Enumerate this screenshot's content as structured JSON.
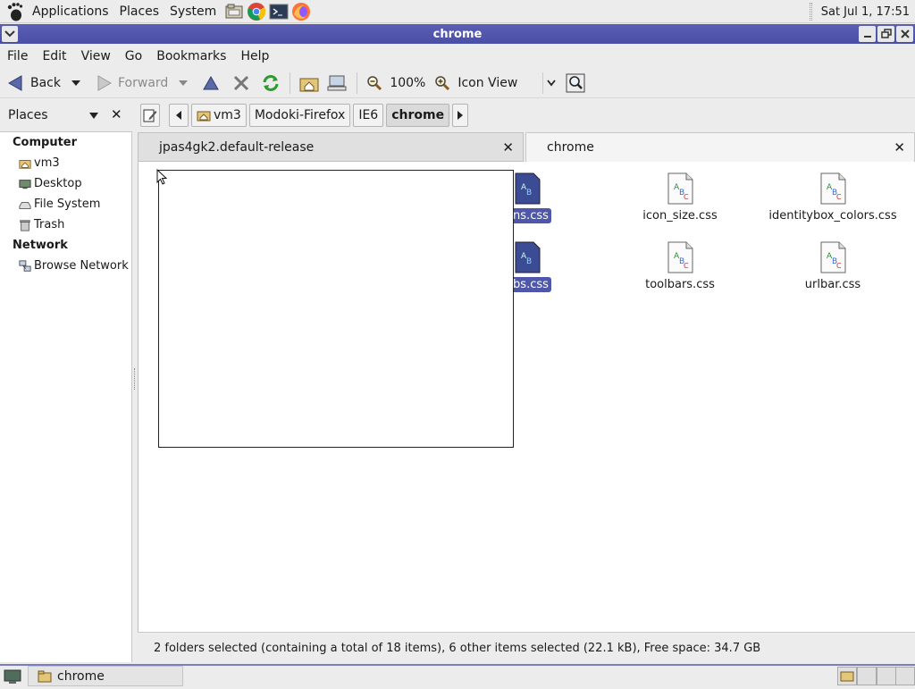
{
  "top_panel": {
    "menus": [
      "Applications",
      "Places",
      "System"
    ],
    "clock": "Sat Jul  1, 17:51",
    "launchers": [
      "file-manager-launcher-icon",
      "chrome-launcher-icon",
      "terminal-launcher-icon",
      "firefox-launcher-icon"
    ]
  },
  "window": {
    "title": "chrome"
  },
  "menubar": {
    "items": [
      "File",
      "Edit",
      "View",
      "Go",
      "Bookmarks",
      "Help"
    ]
  },
  "toolbar": {
    "back": "Back",
    "forward": "Forward",
    "zoom": "100%",
    "view_mode": "Icon View"
  },
  "sidebar": {
    "title": "Places",
    "sections": [
      {
        "heading": "Computer",
        "items": [
          {
            "label": "vm3",
            "icon": "home-folder-icon"
          },
          {
            "label": "Desktop",
            "icon": "desktop-icon"
          },
          {
            "label": "File System",
            "icon": "drive-icon"
          },
          {
            "label": "Trash",
            "icon": "trash-icon"
          }
        ]
      },
      {
        "heading": "Network",
        "items": [
          {
            "label": "Browse Network",
            "icon": "network-icon"
          }
        ]
      }
    ]
  },
  "breadcrumbs": [
    "vm3",
    "Modoki-Firefox",
    "IE6",
    "chrome"
  ],
  "panes": {
    "left_tab": "jpas4gk2.default-release",
    "right_tab": "chrome",
    "files": [
      {
        "name": "ons.css",
        "selected": true
      },
      {
        "name": "icon_size.css",
        "selected": false
      },
      {
        "name": "identitybox_colors.css",
        "selected": false
      },
      {
        "name": "abs.css",
        "selected": true
      },
      {
        "name": "toolbars.css",
        "selected": false
      },
      {
        "name": "urlbar.css",
        "selected": false
      }
    ]
  },
  "status": "2 folders selected (containing a total of 18 items), 6 other items selected (22.1 kB), Free space: 34.7 GB",
  "taskbar": {
    "task_label": "chrome"
  },
  "colors": {
    "selection": "#4f58a8",
    "titlebar": "#5b5fb4"
  }
}
